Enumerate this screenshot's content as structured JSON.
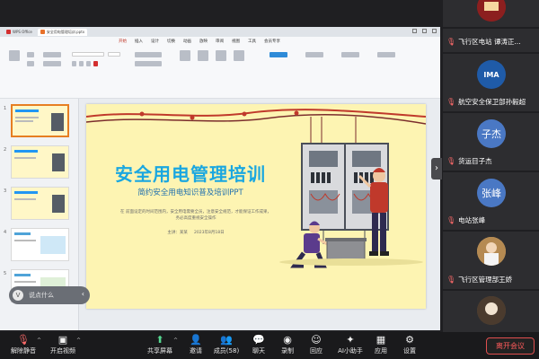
{
  "shared_screen": {
    "tabs": [
      "WPS Office",
      "安全用电管理培训.pptx"
    ],
    "menu": [
      "开始",
      "插入",
      "设计",
      "切换",
      "动画",
      "放映",
      "审阅",
      "视图",
      "工具",
      "会员专享"
    ],
    "slide": {
      "title": "安全用电管理培训",
      "subtitle": "简约安全用电知识普及培训PPT",
      "body": "在 前面设定的时间范围内，安全用电需要全员，注意安全规范，才能保证工作成果，务必高度重视安全操作",
      "meta_presenter": "主讲：某某",
      "meta_date": "2023年8月18日"
    },
    "comment_bubble": "说点什么",
    "thumbnail_numbers": [
      "1",
      "2",
      "3",
      "4",
      "5"
    ]
  },
  "participants": [
    {
      "name": "",
      "avatar": "photo"
    },
    {
      "name": "飞行区电站 谭涛正...",
      "avatar": "photo"
    },
    {
      "name": "航空安全保卫部孙毅超",
      "avatar": "IMA"
    },
    {
      "name": "货运目子杰",
      "avatar": "子杰"
    },
    {
      "name": "电站张峰",
      "avatar": "张峰"
    },
    {
      "name": "飞行区管理部王娇",
      "avatar": "photo"
    },
    {
      "name": "",
      "avatar": "photo"
    }
  ],
  "toolbar": {
    "mute": "解除静音",
    "video": "开启视频",
    "share": "共享屏幕",
    "invite": "邀请",
    "members": "成员(58)",
    "chat": "聊天",
    "record": "录制",
    "react": "回应",
    "ai": "AI小助手",
    "apps": "应用",
    "settings": "设置",
    "leave": "离开会议"
  },
  "colors": {
    "slide_bg": "#fdf4b2",
    "title_blue": "#1aa7e0",
    "leave_red": "#e04f4f",
    "share_green": "#55d68f"
  }
}
